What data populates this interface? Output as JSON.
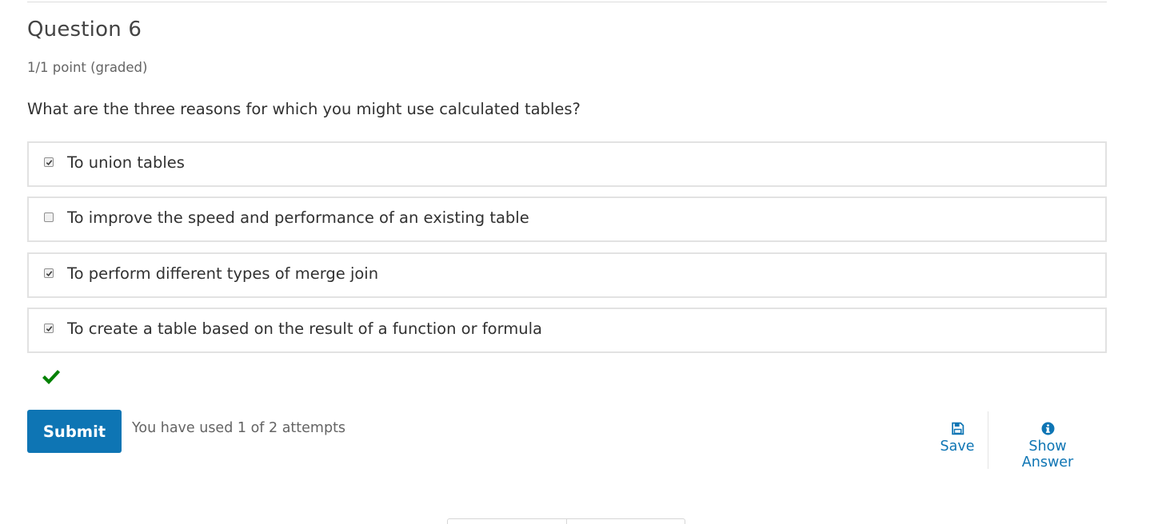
{
  "question": {
    "title": "Question 6",
    "points": "1/1 point (graded)",
    "prompt": "What are the three reasons for which you might use calculated tables?"
  },
  "choices": [
    {
      "label": "To union tables",
      "checked": true
    },
    {
      "label": "To improve the speed and performance of an existing table",
      "checked": false
    },
    {
      "label": "To perform different types of merge join",
      "checked": true
    },
    {
      "label": "To create a table based on the result of a function or formula",
      "checked": true
    }
  ],
  "status": {
    "icon": "checkmark-icon",
    "result": "correct",
    "color": "#008100"
  },
  "actions": {
    "submit_label": "Submit",
    "attempts_text": "You have used 1 of 2 attempts",
    "save_label": "Save",
    "save_icon": "floppy-disk-icon",
    "show_answer_label": "Show Answer",
    "show_answer_icon": "info-circle-icon"
  },
  "colors": {
    "accent": "#0e75b4",
    "border": "#e2e2e2",
    "text": "#313131",
    "muted": "#646464"
  }
}
